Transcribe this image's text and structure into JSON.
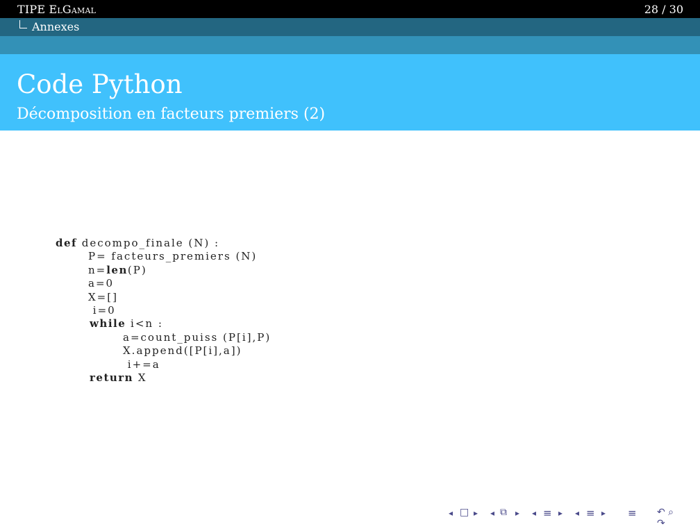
{
  "header": {
    "presentation_title_prefix": "TIPE ",
    "presentation_title_sc": "ElGamal",
    "page_counter": "28 / 30"
  },
  "section": {
    "label": "Annexes"
  },
  "frame": {
    "title": "Code Python",
    "subtitle": "Décomposition en facteurs premiers (2)"
  },
  "code": {
    "lines": [
      {
        "kw": "def",
        "text": " decompo_finale (N) :"
      },
      {
        "kw": "",
        "text": "P= facteurs_premiers (N)"
      },
      {
        "kw": "",
        "text": "n=",
        "kw2": "len",
        "text2": "(P)"
      },
      {
        "kw": "",
        "text": "a=0"
      },
      {
        "kw": "",
        "text": "X=[]"
      },
      {
        "kw": "",
        "text": " i=0"
      },
      {
        "kw": "while",
        "text": " i<n :"
      },
      {
        "kw": "",
        "text": "a=count_puiss (P[i],P)"
      },
      {
        "kw": "",
        "text": "X.append([P[i],a])"
      },
      {
        "kw": "",
        "text": " i+=a"
      },
      {
        "kw": "return",
        "text": " X"
      }
    ]
  },
  "nav": {
    "prev_frame": "◂",
    "frame_icon": "□",
    "next_frame": "▸",
    "prev_sub": "◂",
    "sub_icon": "⧉",
    "next_sub": "▸",
    "prev_section": "◂",
    "section_icon": "≡",
    "next_section": "▸",
    "prev_subsection": "◂",
    "subsection_icon": "≡",
    "next_subsection": "▸",
    "toc_icon": "≡",
    "search_icons": "↶ ⌕ ↷"
  }
}
